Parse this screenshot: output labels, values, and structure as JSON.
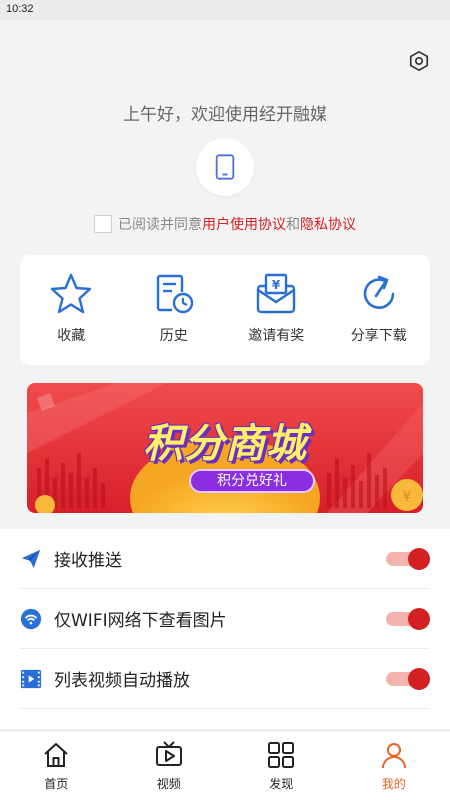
{
  "status": {
    "time": "10:32"
  },
  "header": {
    "greeting": "上午好，欢迎使用经开融媒",
    "agreement": {
      "prefix": "已阅读并同意",
      "user_link": "用户使用协议",
      "and": "和",
      "privacy_link": "隐私协议"
    }
  },
  "quick_actions": [
    {
      "label": "收藏",
      "icon": "star-icon"
    },
    {
      "label": "历史",
      "icon": "history-icon"
    },
    {
      "label": "邀请有奖",
      "icon": "invite-icon"
    },
    {
      "label": "分享下载",
      "icon": "share-icon"
    }
  ],
  "banner": {
    "title": "积分商城",
    "subtitle": "积分兑好礼"
  },
  "settings": [
    {
      "label": "接收推送",
      "icon": "send-icon",
      "enabled": true
    },
    {
      "label": "仅WIFI网络下查看图片",
      "icon": "wifi-icon",
      "enabled": true
    },
    {
      "label": "列表视频自动播放",
      "icon": "video-icon",
      "enabled": true
    }
  ],
  "tabs": [
    {
      "label": "首页",
      "icon": "home-icon",
      "active": false
    },
    {
      "label": "视频",
      "icon": "video-tab-icon",
      "active": false
    },
    {
      "label": "发现",
      "icon": "grid-icon",
      "active": false
    },
    {
      "label": "我的",
      "icon": "user-icon",
      "active": true
    }
  ],
  "colors": {
    "accent": "#d32020",
    "icon_blue": "#2a6fd6",
    "tab_active": "#e8632a"
  }
}
